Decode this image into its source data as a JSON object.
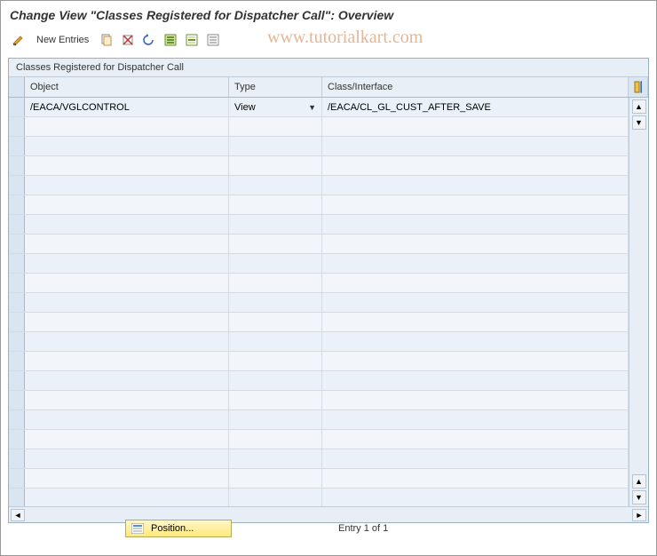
{
  "title": "Change View \"Classes Registered for Dispatcher Call\": Overview",
  "toolbar": {
    "new_entries_label": "New Entries"
  },
  "watermark": "www.tutorialkart.com",
  "panel": {
    "title": "Classes Registered for Dispatcher Call",
    "columns": {
      "object": "Object",
      "type": "Type",
      "class_interface": "Class/Interface"
    },
    "rows": [
      {
        "object": "/EACA/VGLCONTROL",
        "type": "View",
        "class_interface": "/EACA/CL_GL_CUST_AFTER_SAVE"
      }
    ],
    "empty_rows": 20
  },
  "footer": {
    "position_label": "Position...",
    "entry_text": "Entry 1 of 1"
  }
}
